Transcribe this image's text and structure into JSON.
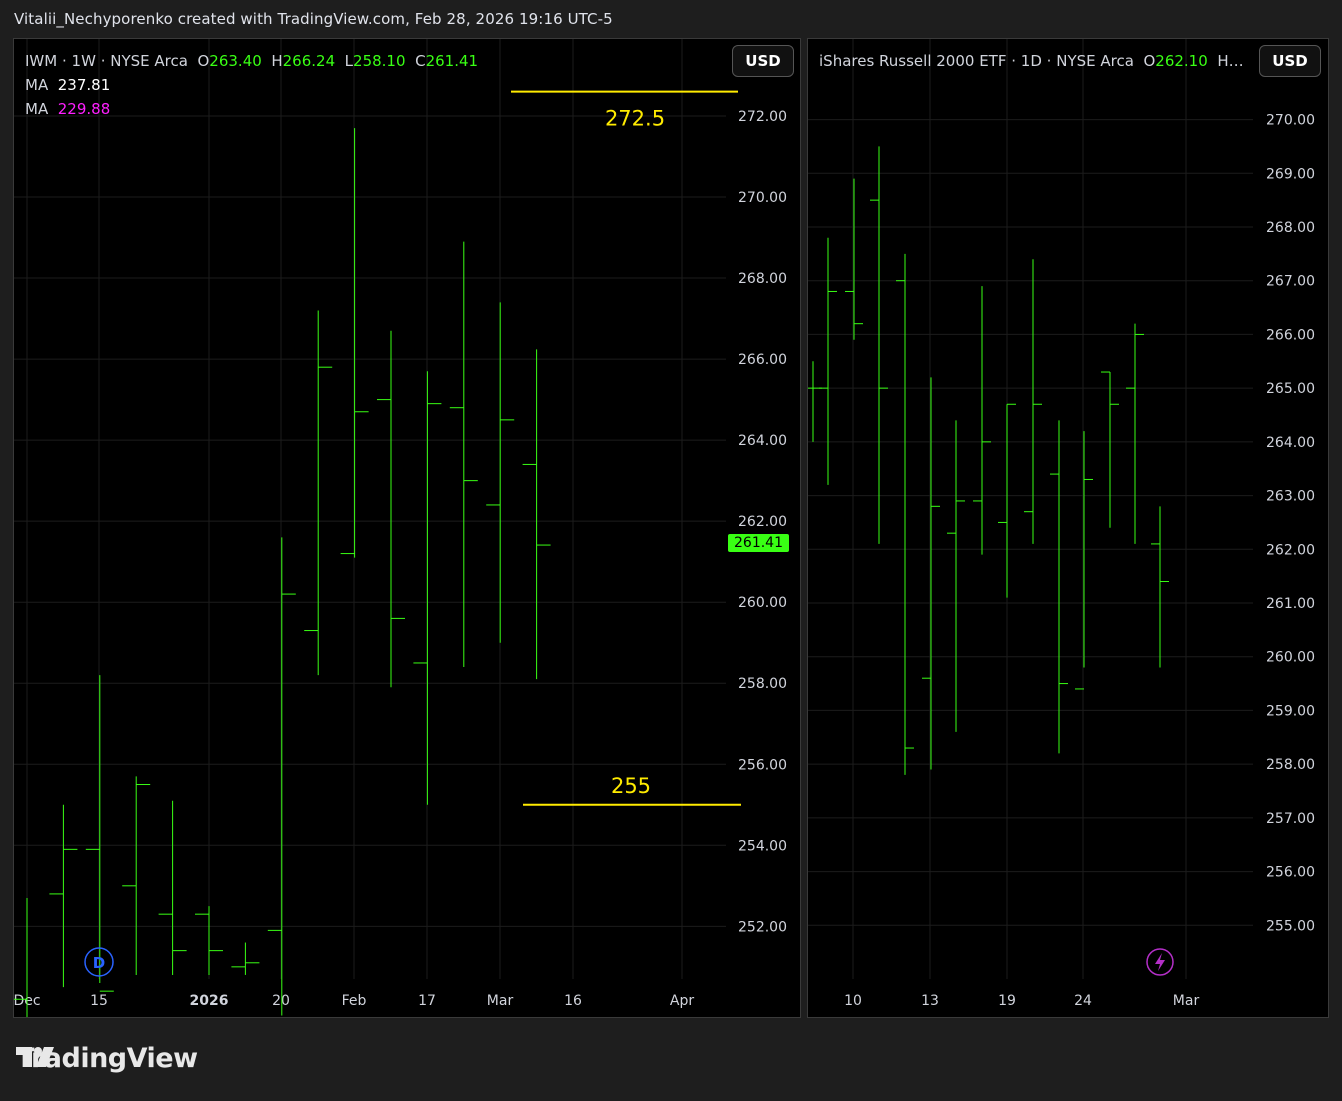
{
  "header": {
    "attribution": "Vitalii_Nechyporenko created with TradingView.com, Feb 28, 2026 19:16 UTC-5"
  },
  "footer": {
    "brand": "TradingView"
  },
  "colors": {
    "bar": "#39ff14",
    "annotation": "#ffeb00",
    "ma2": "#ff1fff",
    "grid": "#1c1c1c",
    "event_d": "#2962ff",
    "event_bolt": "#b42fc8"
  },
  "left": {
    "legend": {
      "symbol": "IWM",
      "interval": "1W",
      "exchange": "NYSE Arca",
      "o_label": "O",
      "o": "263.40",
      "h_label": "H",
      "h": "266.24",
      "l_label": "L",
      "l": "258.10",
      "c_label": "C",
      "c": "261.41",
      "ma_label_1": "MA",
      "ma_value_1": "237.81",
      "ma_label_2": "MA",
      "ma_value_2": "229.88"
    },
    "currency": "USD",
    "last_price": "261.41",
    "event_marker": "D"
  },
  "right": {
    "legend": {
      "symbol": "iShares Russell 2000 ETF",
      "interval": "1D",
      "exchange": "NYSE Arca",
      "o_label": "O",
      "o": "262.10",
      "truncated": "H…"
    },
    "currency": "USD"
  },
  "chart_data": [
    {
      "type": "ohlc",
      "symbol": "IWM",
      "interval": "1W",
      "ylim": [
        250.7,
        273.9
      ],
      "y_ticks": [
        "252.00",
        "254.00",
        "256.00",
        "258.00",
        "260.00",
        "262.00",
        "264.00",
        "266.00",
        "268.00",
        "270.00",
        "272.00"
      ],
      "x_ticks": [
        {
          "label": "Dec",
          "bold": false
        },
        {
          "label": "15",
          "bold": false
        },
        {
          "label": "2026",
          "bold": true
        },
        {
          "label": "20",
          "bold": false
        },
        {
          "label": "Feb",
          "bold": false
        },
        {
          "label": "17",
          "bold": false
        },
        {
          "label": "Mar",
          "bold": false
        },
        {
          "label": "16",
          "bold": false
        },
        {
          "label": "Apr",
          "bold": false
        }
      ],
      "bars": [
        {
          "o": 250.2,
          "h": 252.7,
          "l": 248.0,
          "c": 249.5
        },
        {
          "o": 252.8,
          "h": 255.0,
          "l": 250.5,
          "c": 253.9
        },
        {
          "o": 253.9,
          "h": 258.2,
          "l": 250.6,
          "c": 250.4
        },
        {
          "o": 253.0,
          "h": 255.7,
          "l": 250.8,
          "c": 255.5
        },
        {
          "o": 252.3,
          "h": 255.1,
          "l": 250.8,
          "c": 251.4
        },
        {
          "o": 252.3,
          "h": 252.5,
          "l": 250.8,
          "c": 251.4
        },
        {
          "o": 251.0,
          "h": 251.6,
          "l": 250.8,
          "c": 251.1
        },
        {
          "o": 251.9,
          "h": 261.6,
          "l": 249.8,
          "c": 260.2
        },
        {
          "o": 259.3,
          "h": 267.2,
          "l": 258.2,
          "c": 265.8
        },
        {
          "o": 261.2,
          "h": 271.7,
          "l": 261.1,
          "c": 264.7
        },
        {
          "o": 265.0,
          "h": 266.7,
          "l": 257.9,
          "c": 259.6
        },
        {
          "o": 258.5,
          "h": 265.7,
          "l": 255.0,
          "c": 264.9
        },
        {
          "o": 264.8,
          "h": 268.9,
          "l": 258.4,
          "c": 263.0
        },
        {
          "o": 262.4,
          "h": 267.4,
          "l": 259.0,
          "c": 264.5
        },
        {
          "o": 263.4,
          "h": 266.24,
          "l": 258.1,
          "c": 261.41
        }
      ],
      "annotations": [
        {
          "label": "272.5",
          "value": 272.6
        },
        {
          "label": "255",
          "value": 255.0
        }
      ]
    },
    {
      "type": "ohlc",
      "symbol": "iShares Russell 2000 ETF",
      "interval": "1D",
      "ylim": [
        254.0,
        271.5
      ],
      "y_ticks": [
        "255.00",
        "256.00",
        "257.00",
        "258.00",
        "259.00",
        "260.00",
        "261.00",
        "262.00",
        "263.00",
        "264.00",
        "265.00",
        "266.00",
        "267.00",
        "268.00",
        "269.00",
        "270.00"
      ],
      "x_ticks": [
        {
          "label": "10",
          "bold": false
        },
        {
          "label": "13",
          "bold": false
        },
        {
          "label": "19",
          "bold": false
        },
        {
          "label": "24",
          "bold": false
        },
        {
          "label": "Mar",
          "bold": false
        }
      ],
      "bars": [
        {
          "o": 265.0,
          "h": 265.5,
          "l": 264.0,
          "c": 265.0
        },
        {
          "o": 265.0,
          "h": 267.8,
          "l": 263.2,
          "c": 266.8
        },
        {
          "o": 266.8,
          "h": 268.9,
          "l": 265.9,
          "c": 266.2
        },
        {
          "o": 268.5,
          "h": 269.5,
          "l": 262.1,
          "c": 265.0
        },
        {
          "o": 267.0,
          "h": 267.5,
          "l": 257.8,
          "c": 258.3
        },
        {
          "o": 259.6,
          "h": 265.2,
          "l": 257.9,
          "c": 262.8
        },
        {
          "o": 262.3,
          "h": 264.4,
          "l": 258.6,
          "c": 262.9
        },
        {
          "o": 262.9,
          "h": 266.9,
          "l": 261.9,
          "c": 264.0
        },
        {
          "o": 262.5,
          "h": 264.7,
          "l": 261.1,
          "c": 264.7
        },
        {
          "o": 262.7,
          "h": 267.4,
          "l": 262.1,
          "c": 264.7
        },
        {
          "o": 263.4,
          "h": 264.4,
          "l": 258.2,
          "c": 259.5
        },
        {
          "o": 259.4,
          "h": 264.2,
          "l": 259.8,
          "c": 263.3
        },
        {
          "o": 265.3,
          "h": 265.3,
          "l": 262.4,
          "c": 264.7
        },
        {
          "o": 265.0,
          "h": 266.2,
          "l": 262.1,
          "c": 266.0
        },
        {
          "o": 262.1,
          "h": 262.8,
          "l": 259.8,
          "c": 261.4
        }
      ]
    }
  ]
}
